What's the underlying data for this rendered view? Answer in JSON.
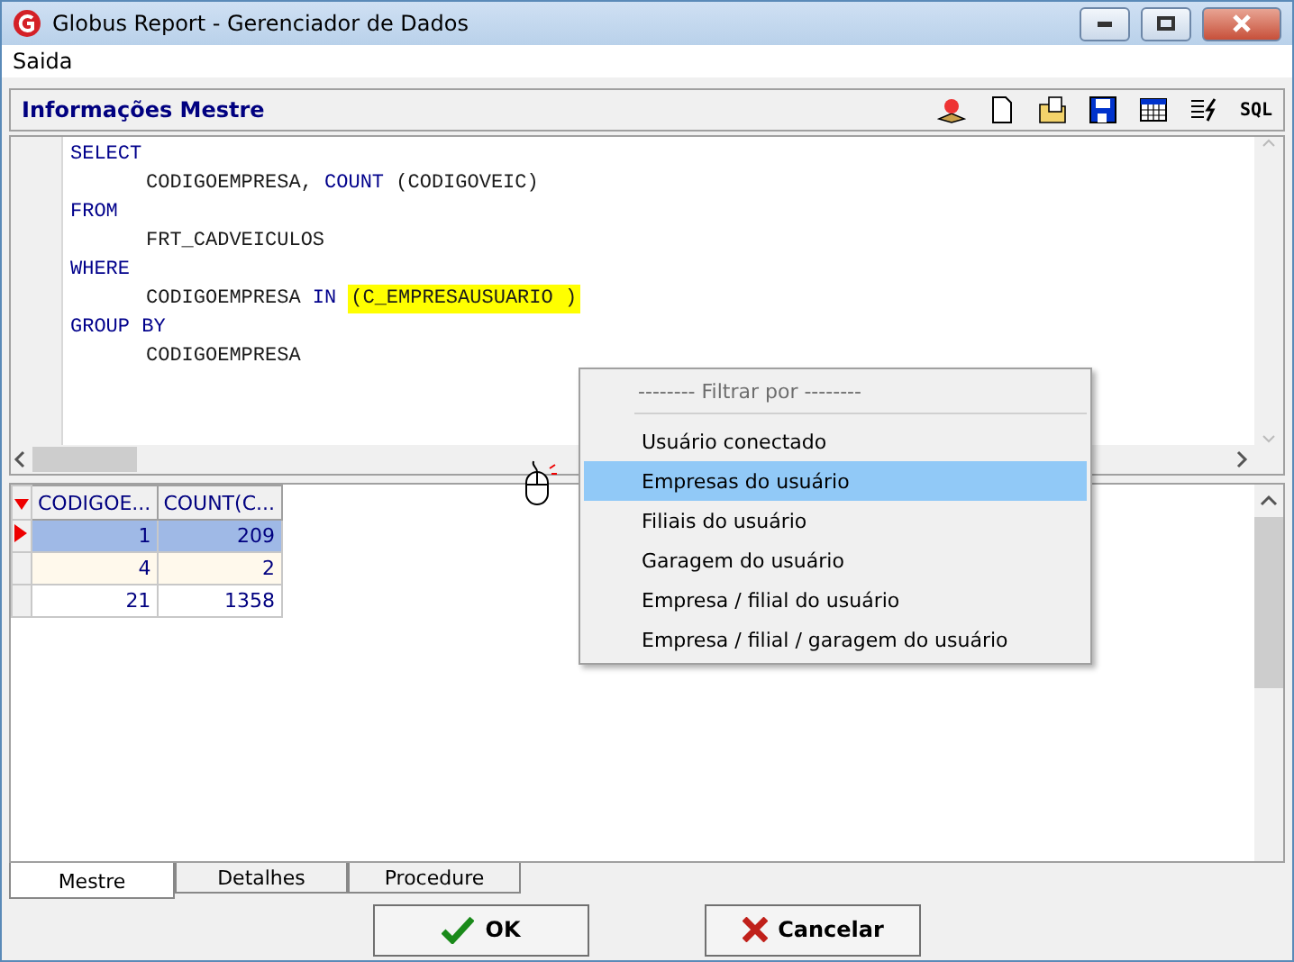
{
  "window": {
    "title": "Globus Report - Gerenciador de Dados"
  },
  "menu": [
    "Saida"
  ],
  "panel": {
    "title": "Informações Mestre",
    "toolbar_text": "SQL"
  },
  "sql": [
    {
      "indented": false,
      "tokens": [
        {
          "text": "SELECT",
          "kind": "keyword"
        }
      ]
    },
    {
      "indented": true,
      "tokens": [
        {
          "text": "CODIGOEMPRESA, ",
          "kind": "ident"
        },
        {
          "text": "COUNT",
          "kind": "keyword"
        },
        {
          "text": " (CODIGOVEIC)",
          "kind": "ident"
        }
      ]
    },
    {
      "indented": false,
      "tokens": [
        {
          "text": "FROM",
          "kind": "keyword"
        }
      ]
    },
    {
      "indented": true,
      "tokens": [
        {
          "text": "FRT_CADVEICULOS",
          "kind": "ident"
        }
      ]
    },
    {
      "indented": false,
      "tokens": [
        {
          "text": "WHERE",
          "kind": "keyword"
        }
      ]
    },
    {
      "indented": true,
      "tokens": [
        {
          "text": "CODIGOEMPRESA ",
          "kind": "ident"
        },
        {
          "text": "IN",
          "kind": "keyword"
        },
        {
          "text": "(C_EMPRESAUSUARIO )",
          "kind": "parameter"
        }
      ]
    },
    {
      "indented": false,
      "tokens": [
        {
          "text": "GROUP BY",
          "kind": "keyword"
        }
      ]
    },
    {
      "indented": true,
      "tokens": [
        {
          "text": "CODIGOEMPRESA",
          "kind": "ident"
        }
      ]
    }
  ],
  "grid": {
    "columns": [
      "CODIGOE...",
      "COUNT(C..."
    ],
    "rows": [
      {
        "selected": true,
        "cells": [
          "1",
          "209"
        ]
      },
      {
        "selected": false,
        "cells": [
          "4",
          "2"
        ]
      },
      {
        "selected": false,
        "cells": [
          "21",
          "1358"
        ]
      }
    ]
  },
  "context_menu": {
    "heading": "-------- Filtrar por --------",
    "items": [
      {
        "label": "Usuário conectado",
        "selected": false
      },
      {
        "label": "Empresas do usuário",
        "selected": true
      },
      {
        "label": "Filiais do usuário",
        "selected": false
      },
      {
        "label": "Garagem do usuário",
        "selected": false
      },
      {
        "label": "Empresa / filial do usuário",
        "selected": false
      },
      {
        "label": "Empresa / filial / garagem do usuário",
        "selected": false
      }
    ]
  },
  "tabs": [
    {
      "label": "Mestre",
      "selected": true
    },
    {
      "label": "Detalhes",
      "selected": false
    },
    {
      "label": "Procedure",
      "selected": false
    }
  ],
  "buttons": [
    {
      "label": "OK",
      "kind": "ok"
    },
    {
      "label": "Cancelar",
      "kind": "cancel"
    }
  ]
}
